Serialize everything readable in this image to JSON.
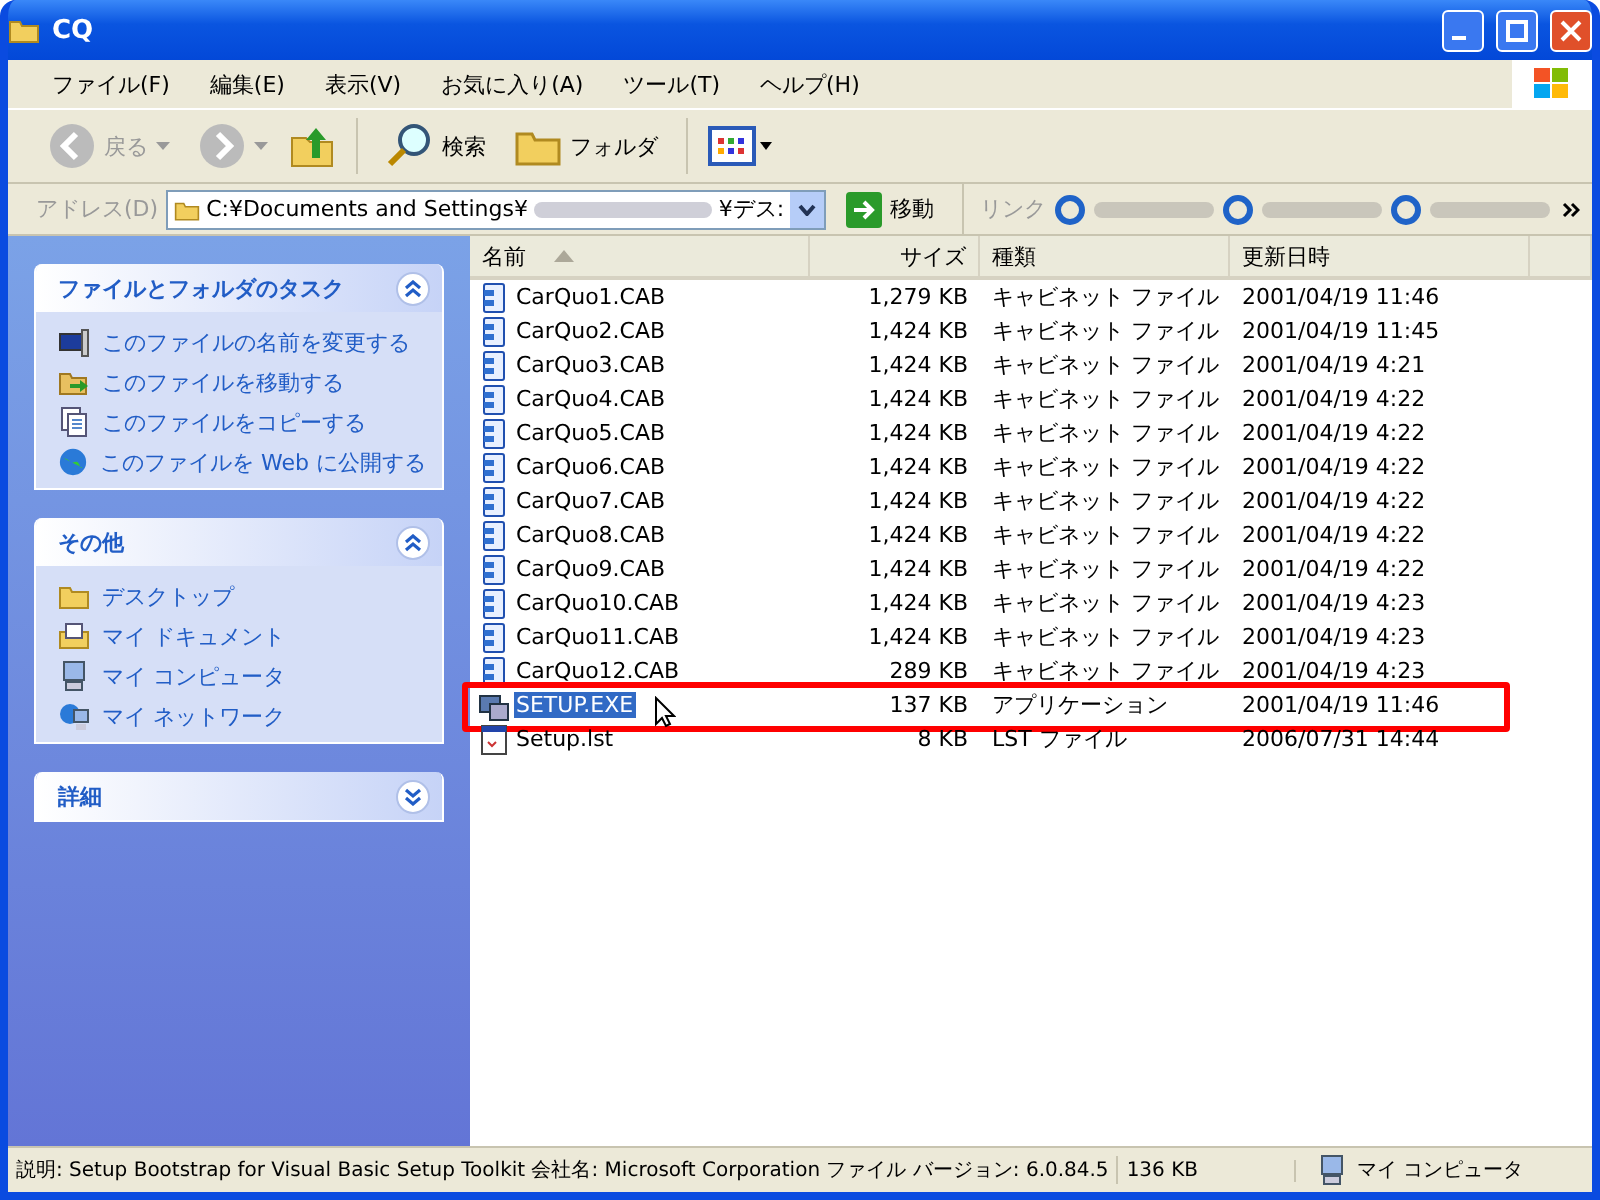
{
  "window": {
    "title": "CQ"
  },
  "menu": [
    "ファイル(F)",
    "編集(E)",
    "表示(V)",
    "お気に入り(A)",
    "ツール(T)",
    "ヘルプ(H)"
  ],
  "toolbar": {
    "back": "戻る",
    "search": "検索",
    "folders": "フォルダ"
  },
  "address": {
    "label": "アドレス(D)",
    "path_start": "C:¥Documents and Settings¥",
    "path_end": "¥デス:",
    "go": "移動",
    "links": "リンク"
  },
  "panels": [
    {
      "title": "ファイルとフォルダのタスク",
      "expanded": true,
      "items": [
        {
          "kind": "rename",
          "label": "このファイルの名前を変更する"
        },
        {
          "kind": "move",
          "label": "このファイルを移動する"
        },
        {
          "kind": "copy",
          "label": "このファイルをコピーする"
        },
        {
          "kind": "web",
          "label": "このファイルを Web に公開する"
        }
      ]
    },
    {
      "title": "その他",
      "expanded": true,
      "items": [
        {
          "kind": "folder",
          "label": "デスクトップ"
        },
        {
          "kind": "docs",
          "label": "マイ ドキュメント"
        },
        {
          "kind": "computer",
          "label": "マイ コンピュータ"
        },
        {
          "kind": "network",
          "label": "マイ ネットワーク"
        }
      ]
    },
    {
      "title": "詳細",
      "expanded": false
    }
  ],
  "table": {
    "columns": [
      "名前",
      "サイズ",
      "種類",
      "更新日時"
    ],
    "rows": [
      {
        "kind": "cab",
        "name": "CarQuo1.CAB",
        "size": "1,279 KB",
        "type": "キャビネット ファイル",
        "date": "2001/04/19 11:46",
        "selected": false,
        "highlighted": false
      },
      {
        "kind": "cab",
        "name": "CarQuo2.CAB",
        "size": "1,424 KB",
        "type": "キャビネット ファイル",
        "date": "2001/04/19 11:45",
        "selected": false,
        "highlighted": false
      },
      {
        "kind": "cab",
        "name": "CarQuo3.CAB",
        "size": "1,424 KB",
        "type": "キャビネット ファイル",
        "date": "2001/04/19 4:21",
        "selected": false,
        "highlighted": false
      },
      {
        "kind": "cab",
        "name": "CarQuo4.CAB",
        "size": "1,424 KB",
        "type": "キャビネット ファイル",
        "date": "2001/04/19 4:22",
        "selected": false,
        "highlighted": false
      },
      {
        "kind": "cab",
        "name": "CarQuo5.CAB",
        "size": "1,424 KB",
        "type": "キャビネット ファイル",
        "date": "2001/04/19 4:22",
        "selected": false,
        "highlighted": false
      },
      {
        "kind": "cab",
        "name": "CarQuo6.CAB",
        "size": "1,424 KB",
        "type": "キャビネット ファイル",
        "date": "2001/04/19 4:22",
        "selected": false,
        "highlighted": false
      },
      {
        "kind": "cab",
        "name": "CarQuo7.CAB",
        "size": "1,424 KB",
        "type": "キャビネット ファイル",
        "date": "2001/04/19 4:22",
        "selected": false,
        "highlighted": false
      },
      {
        "kind": "cab",
        "name": "CarQuo8.CAB",
        "size": "1,424 KB",
        "type": "キャビネット ファイル",
        "date": "2001/04/19 4:22",
        "selected": false,
        "highlighted": false
      },
      {
        "kind": "cab",
        "name": "CarQuo9.CAB",
        "size": "1,424 KB",
        "type": "キャビネット ファイル",
        "date": "2001/04/19 4:22",
        "selected": false,
        "highlighted": false
      },
      {
        "kind": "cab",
        "name": "CarQuo10.CAB",
        "size": "1,424 KB",
        "type": "キャビネット ファイル",
        "date": "2001/04/19 4:23",
        "selected": false,
        "highlighted": false
      },
      {
        "kind": "cab",
        "name": "CarQuo11.CAB",
        "size": "1,424 KB",
        "type": "キャビネット ファイル",
        "date": "2001/04/19 4:23",
        "selected": false,
        "highlighted": false
      },
      {
        "kind": "cab",
        "name": "CarQuo12.CAB",
        "size": "289 KB",
        "type": "キャビネット ファイル",
        "date": "2001/04/19 4:23",
        "selected": false,
        "highlighted": false
      },
      {
        "kind": "exe",
        "name": "SETUP.EXE",
        "size": "137 KB",
        "type": "アプリケーション",
        "date": "2001/04/19 11:46",
        "selected": true,
        "highlighted": true
      },
      {
        "kind": "lst",
        "name": "Setup.lst",
        "size": "8 KB",
        "type": "LST ファイル",
        "date": "2006/07/31 14:44",
        "selected": false,
        "highlighted": false
      }
    ]
  },
  "status_bar": {
    "description": "説明: Setup Bootstrap for Visual Basic Setup Toolkit 会社名: Microsoft Corporation ファイル バージョン: 6.0.84.5",
    "size": "136 KB",
    "zone": "マイ コンピュータ"
  }
}
